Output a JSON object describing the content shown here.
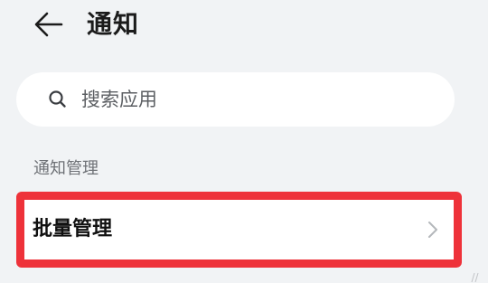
{
  "header": {
    "title": "通知",
    "back_icon": "arrow-left-icon"
  },
  "search": {
    "placeholder": "搜索应用",
    "value": "",
    "icon": "search-icon"
  },
  "section": {
    "label": "通知管理"
  },
  "list": {
    "items": [
      {
        "label": "批量管理",
        "icon": "chevron-right-icon"
      }
    ]
  },
  "colors": {
    "background": "#f1f3f5",
    "card": "#ffffff",
    "highlight_border": "#ee323a",
    "primary_text": "#1b1b1b",
    "secondary_text": "#6e7176"
  }
}
